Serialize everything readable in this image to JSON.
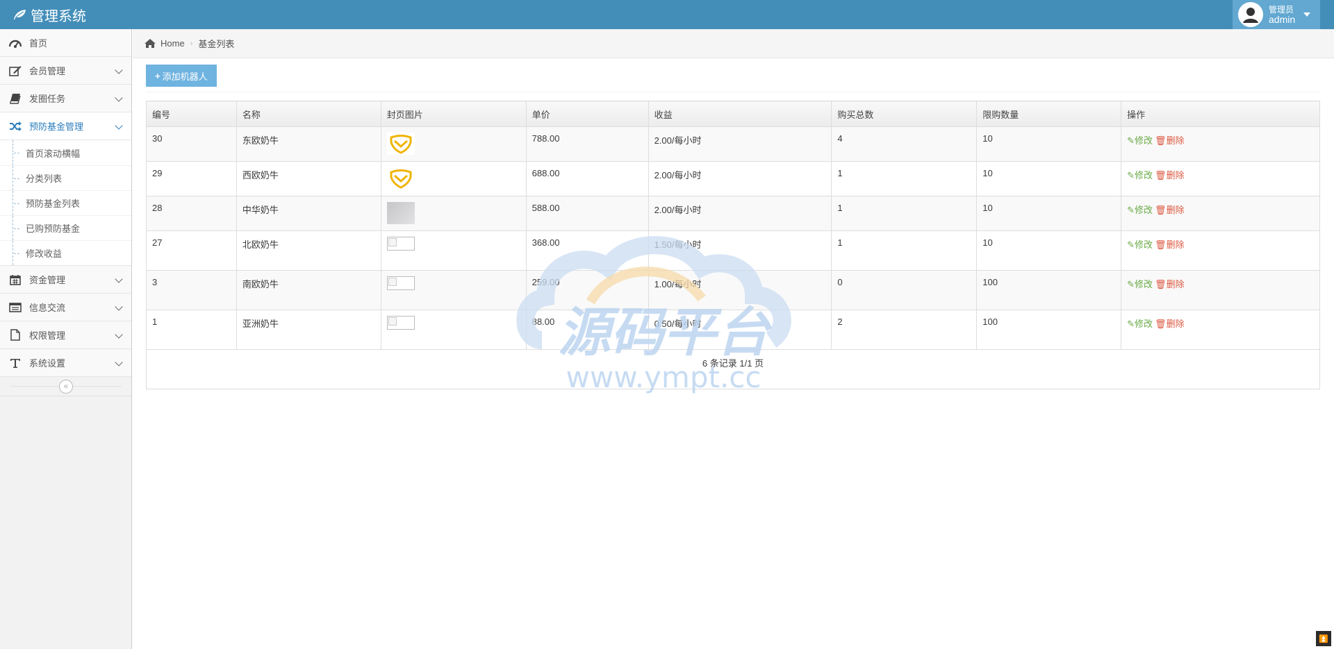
{
  "app": {
    "title": "管理系统"
  },
  "user": {
    "role": "管理员",
    "name": "admin"
  },
  "sidebar": {
    "items": [
      {
        "label": "首页",
        "icon": "dashboard-icon"
      },
      {
        "label": "会员管理",
        "icon": "edit-icon"
      },
      {
        "label": "发圈任务",
        "icon": "book-icon"
      },
      {
        "label": "预防基金管理",
        "icon": "shuffle-icon"
      },
      {
        "label": "资金管理",
        "icon": "calendar-icon"
      },
      {
        "label": "信息交流",
        "icon": "list-alt-icon"
      },
      {
        "label": "权限管理",
        "icon": "file-icon"
      },
      {
        "label": "系统设置",
        "icon": "text-icon"
      }
    ],
    "submenu": [
      "首页滚动横幅",
      "分类列表",
      "预防基金列表",
      "已购预防基金",
      "修改收益"
    ],
    "collapse_glyph": "«"
  },
  "breadcrumb": {
    "home": "Home",
    "sep": "›",
    "current": "基金列表"
  },
  "toolbar": {
    "add_label": "添加机器人"
  },
  "table": {
    "headers": [
      "编号",
      "名称",
      "封页图片",
      "单价",
      "收益",
      "购买总数",
      "限购数量",
      "操作"
    ],
    "rows": [
      {
        "id": "30",
        "name": "东欧奶牛",
        "image": "shield-logo",
        "price": "788.00",
        "income": "2.00/每小时",
        "bought": "4",
        "limit": "10"
      },
      {
        "id": "29",
        "name": "西欧奶牛",
        "image": "shield-logo",
        "price": "688.00",
        "income": "2.00/每小时",
        "bought": "1",
        "limit": "10"
      },
      {
        "id": "28",
        "name": "中华奶牛",
        "image": "blurred-photo",
        "price": "588.00",
        "income": "2.00/每小时",
        "bought": "1",
        "limit": "10"
      },
      {
        "id": "27",
        "name": "北欧奶牛",
        "image": "broken-image",
        "price": "368.00",
        "income": "1.50/每小时",
        "bought": "1",
        "limit": "10"
      },
      {
        "id": "3",
        "name": "南欧奶牛",
        "image": "broken-image",
        "price": "259.00",
        "income": "1.00/每小时",
        "bought": "0",
        "limit": "100"
      },
      {
        "id": "1",
        "name": "亚洲奶牛",
        "image": "broken-image",
        "price": "88.00",
        "income": "0.50/每小时",
        "bought": "2",
        "limit": "100"
      }
    ],
    "edit_label": "修改",
    "delete_label": "删除",
    "pager": "6 条记录 1/1 页"
  },
  "watermark": {
    "main": "源码平台",
    "url": "www.ympt.cc"
  },
  "colors": {
    "navbar": "#438eb9",
    "user_box": "#62a8d1",
    "add_button": "#6fb3e0",
    "edit": "#69aa46",
    "delete": "#dd5a43",
    "active_nav": "#2b7dbc"
  }
}
